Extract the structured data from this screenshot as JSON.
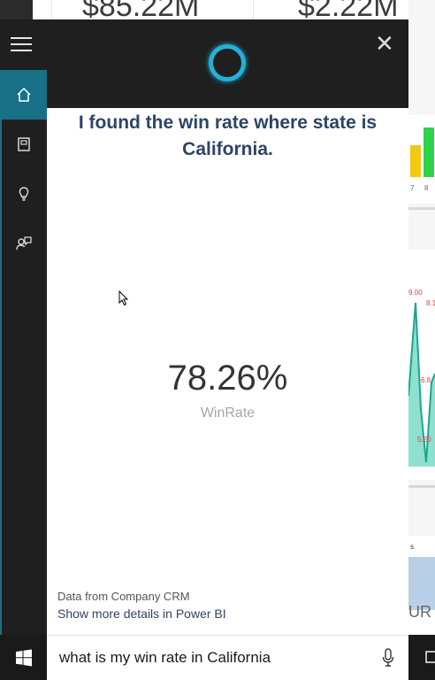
{
  "background": {
    "tile1_value": "$85.22M",
    "tile2_value": "$2.22M",
    "axis_ticks": [
      "7",
      "8"
    ],
    "chart_labels": [
      "9.00",
      "8.1",
      "6.8",
      "5.20"
    ],
    "map_text": "UR",
    "card_text": "s"
  },
  "cortana": {
    "answer_title": "I found the win rate where state is California.",
    "kpi_value": "78.26%",
    "kpi_label": "WinRate",
    "source_text": "Data from Company CRM",
    "details_link": "Show more details in Power BI"
  },
  "nav": {
    "items": [
      {
        "icon": "home-icon"
      },
      {
        "icon": "notebook-icon"
      },
      {
        "icon": "lightbulb-icon"
      },
      {
        "icon": "feedback-icon"
      }
    ]
  },
  "search": {
    "query": "what is my win rate in California"
  },
  "colors": {
    "panel_dark": "#1f1f1f",
    "accent": "#177086",
    "cortana_ring": "#23b1d8",
    "title_text": "#2d4565"
  }
}
